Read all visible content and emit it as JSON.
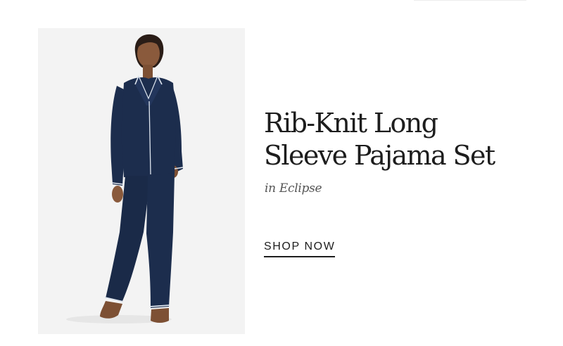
{
  "product": {
    "title_line1": "Rib-Knit Long",
    "title_line2": "Sleeve Pajama Set",
    "color_variant": "in Eclipse",
    "cta_label": "SHOP NOW"
  },
  "colors": {
    "garment": "#1c2d4d",
    "piping": "#dfe6ef",
    "background": "#f3f3f3",
    "text": "#1d1d1d"
  }
}
